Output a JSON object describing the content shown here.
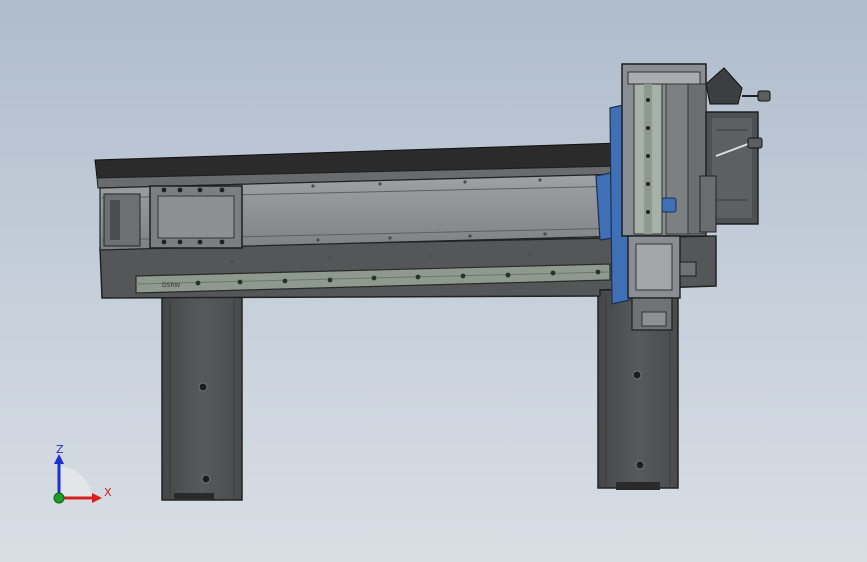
{
  "viewport": {
    "background_top": "#aebccb",
    "background_bottom": "#d9dee4"
  },
  "model": {
    "frame_color": "#505152",
    "rail_color": "#8f9a8e",
    "carriage_accent": "#3f6fb5",
    "rail_marking": "DSRW"
  },
  "triad": {
    "z_label": "Z",
    "x_label": "X",
    "z_color": "#1f2fd6",
    "x_color": "#d61f1f",
    "origin_color": "#1aa02a"
  }
}
